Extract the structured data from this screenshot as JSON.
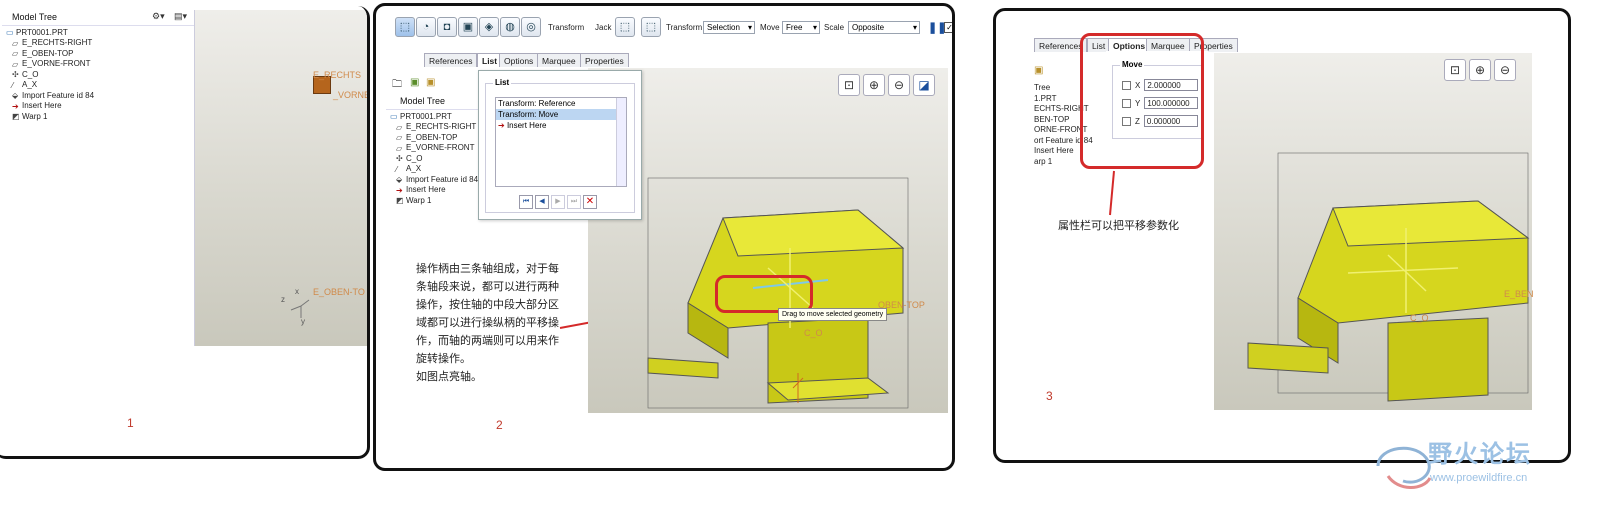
{
  "panel1": {
    "model_tree_title": "Model Tree",
    "tree_items": [
      {
        "label": "PRT0001.PRT",
        "icon": "part-icon"
      },
      {
        "label": "E_RECHTS-RIGHT",
        "icon": "datum-plane-icon"
      },
      {
        "label": "E_OBEN-TOP",
        "icon": "datum-plane-icon"
      },
      {
        "label": "E_VORNE-FRONT",
        "icon": "datum-plane-icon"
      },
      {
        "label": "C_O",
        "icon": "coordinate-system-icon"
      },
      {
        "label": "A_X",
        "icon": "axis-icon"
      },
      {
        "label": "Import Feature id 84",
        "icon": "import-feature-icon"
      },
      {
        "label": "Insert Here",
        "icon": "insert-arrow-icon"
      },
      {
        "label": "Warp 1",
        "icon": "warp-icon"
      }
    ],
    "view_labels": {
      "rechts": "E_RECHTS",
      "vorne": "_VORNE",
      "oben": "E_OBEN-TO",
      "x": "x",
      "y": "y",
      "z": "z"
    },
    "number": "1"
  },
  "panel2": {
    "toolbar": {
      "transform_label": "Transform",
      "jack_label": "Jack",
      "transform2_label": "Transform",
      "transform_value": "Selection",
      "move_label": "Move",
      "move_value": "Free",
      "scale_label": "Scale",
      "scale_value": "Opposite"
    },
    "tabs": [
      "References",
      "List",
      "Options",
      "Marquee",
      "Properties"
    ],
    "list_popup": {
      "group_title": "List",
      "items": [
        "Transform: Reference",
        "Transform: Move",
        "Insert Here"
      ]
    },
    "model_tree_title": "Model Tree",
    "tree_items": [
      {
        "label": "PRT0001.PRT",
        "icon": "part-icon"
      },
      {
        "label": "E_RECHTS-RIGHT",
        "icon": "datum-plane-icon"
      },
      {
        "label": "E_OBEN-TOP",
        "icon": "datum-plane-icon"
      },
      {
        "label": "E_VORNE-FRONT",
        "icon": "datum-plane-icon"
      },
      {
        "label": "C_O",
        "icon": "coordinate-system-icon"
      },
      {
        "label": "A_X",
        "icon": "axis-icon"
      },
      {
        "label": "Import Feature id 84",
        "icon": "import-feature-icon"
      },
      {
        "label": "Insert Here",
        "icon": "insert-arrow-icon"
      },
      {
        "label": "Warp 1",
        "icon": "warp-icon"
      }
    ],
    "caption_lines": [
      "操作柄由三条轴组成，对于每",
      "条轴段来说，都可以进行两种",
      "操作，按住轴的中段大部分区",
      "域都可以进行操纵柄的平移操",
      "作，而轴的两端则可以用来作",
      "旋转操作。",
      "如图点亮轴。"
    ],
    "tooltip": "Drag to move selected geometry",
    "view_labels": {
      "oben": "OBEN-TOP",
      "co": "C_O"
    },
    "number": "2"
  },
  "panel3": {
    "tabs": [
      "References",
      "List",
      "Options",
      "Marquee",
      "Properties"
    ],
    "move_group_title": "Move",
    "fields": [
      {
        "axis": "X",
        "value": "2.000000"
      },
      {
        "axis": "Y",
        "value": "100.000000"
      },
      {
        "axis": "Z",
        "value": "0.000000"
      }
    ],
    "tree_partial": [
      "Tree",
      "1.PRT",
      "ECHTS-RIGHT",
      "BEN-TOP",
      "ORNE-FRONT",
      "ort Feature id 84",
      "Insert Here",
      "arp 1"
    ],
    "caption": "属性栏可以把平移参数化",
    "view_labels": {
      "co": "C_O",
      "beno": "E_BEN"
    },
    "number": "3"
  },
  "watermark": {
    "title": "野火论坛",
    "url": "www.proewildfire.cn"
  },
  "colors": {
    "frame": "#111111",
    "highlight_red": "#d42a2a",
    "model_yellow": "#e3e32a",
    "selection_blue": "#bcd6f2"
  }
}
